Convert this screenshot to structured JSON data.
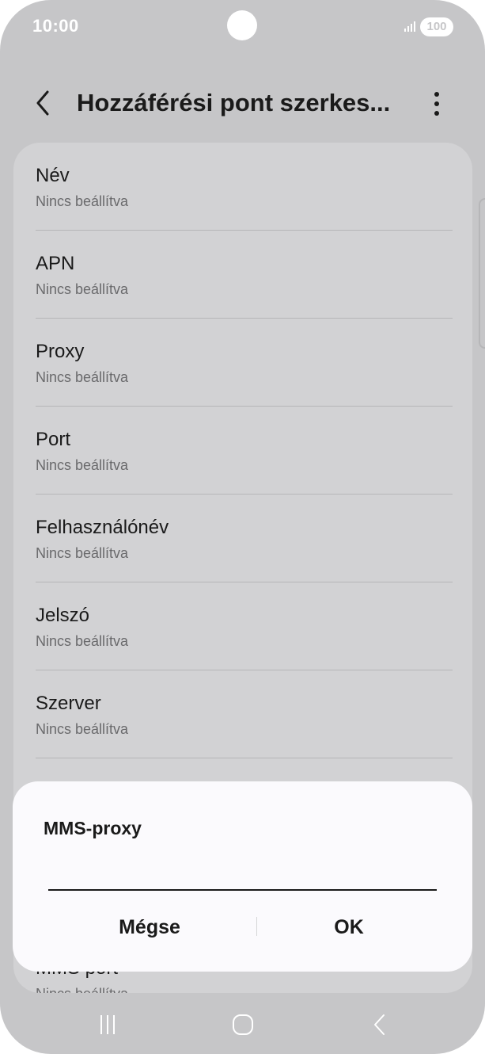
{
  "status_bar": {
    "time": "10:00",
    "battery": "100"
  },
  "header": {
    "title": "Hozzáférési pont szerkes..."
  },
  "list": {
    "items": [
      {
        "title": "Név",
        "subtitle": "Nincs beállítva"
      },
      {
        "title": "APN",
        "subtitle": "Nincs beállítva"
      },
      {
        "title": "Proxy",
        "subtitle": "Nincs beállítva"
      },
      {
        "title": "Port",
        "subtitle": "Nincs beállítva"
      },
      {
        "title": "Felhasználónév",
        "subtitle": "Nincs beállítva"
      },
      {
        "title": "Jelszó",
        "subtitle": "Nincs beállítva"
      },
      {
        "title": "Szerver",
        "subtitle": "Nincs beállítva"
      },
      {
        "title": "MMS port",
        "subtitle": "Nincs beállítva"
      }
    ]
  },
  "dialog": {
    "title": "MMS-proxy",
    "input_value": "",
    "cancel_label": "Mégse",
    "ok_label": "OK"
  },
  "colors": {
    "background": "#c6c6c8",
    "card": "#d2d2d4",
    "dialog": "#fbfafd",
    "text": "#1a1a1a",
    "subtext": "#6a6a6c"
  },
  "icons": {
    "back": "chevron-left-icon",
    "more": "more-vertical-icon",
    "signal": "signal-icon",
    "nav_recent": "recent-apps-icon",
    "nav_home": "home-icon",
    "nav_back": "nav-back-icon"
  }
}
